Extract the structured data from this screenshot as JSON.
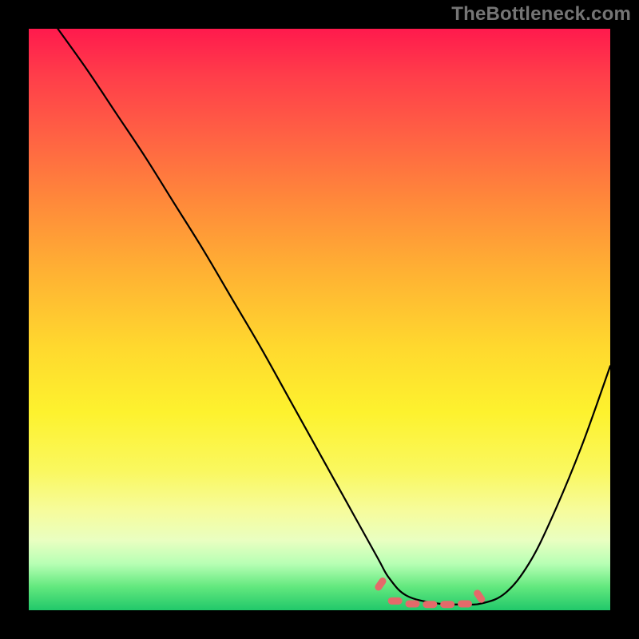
{
  "watermark": "TheBottleneck.com",
  "chart_data": {
    "type": "line",
    "title": "",
    "xlabel": "",
    "ylabel": "",
    "xlim": [
      0,
      100
    ],
    "ylim": [
      0,
      100
    ],
    "grid": false,
    "legend": false,
    "series": [
      {
        "name": "curve",
        "x": [
          5,
          10,
          15,
          20,
          25,
          30,
          35,
          40,
          45,
          50,
          55,
          60,
          62,
          65,
          70,
          74,
          78,
          82,
          86,
          90,
          95,
          100
        ],
        "values": [
          100,
          93,
          85.5,
          78,
          70,
          62,
          53.5,
          45,
          36,
          27,
          18,
          9,
          5.5,
          2.5,
          1.2,
          1,
          1.2,
          3,
          8,
          16,
          28,
          42
        ]
      }
    ],
    "markers": {
      "name": "optimal-zone",
      "color": "#e46a6a",
      "points_x": [
        60.5,
        63,
        66,
        69,
        72,
        75,
        77.5
      ],
      "points_y": [
        4.5,
        1.6,
        1.1,
        1.0,
        1.0,
        1.1,
        2.4
      ]
    }
  }
}
